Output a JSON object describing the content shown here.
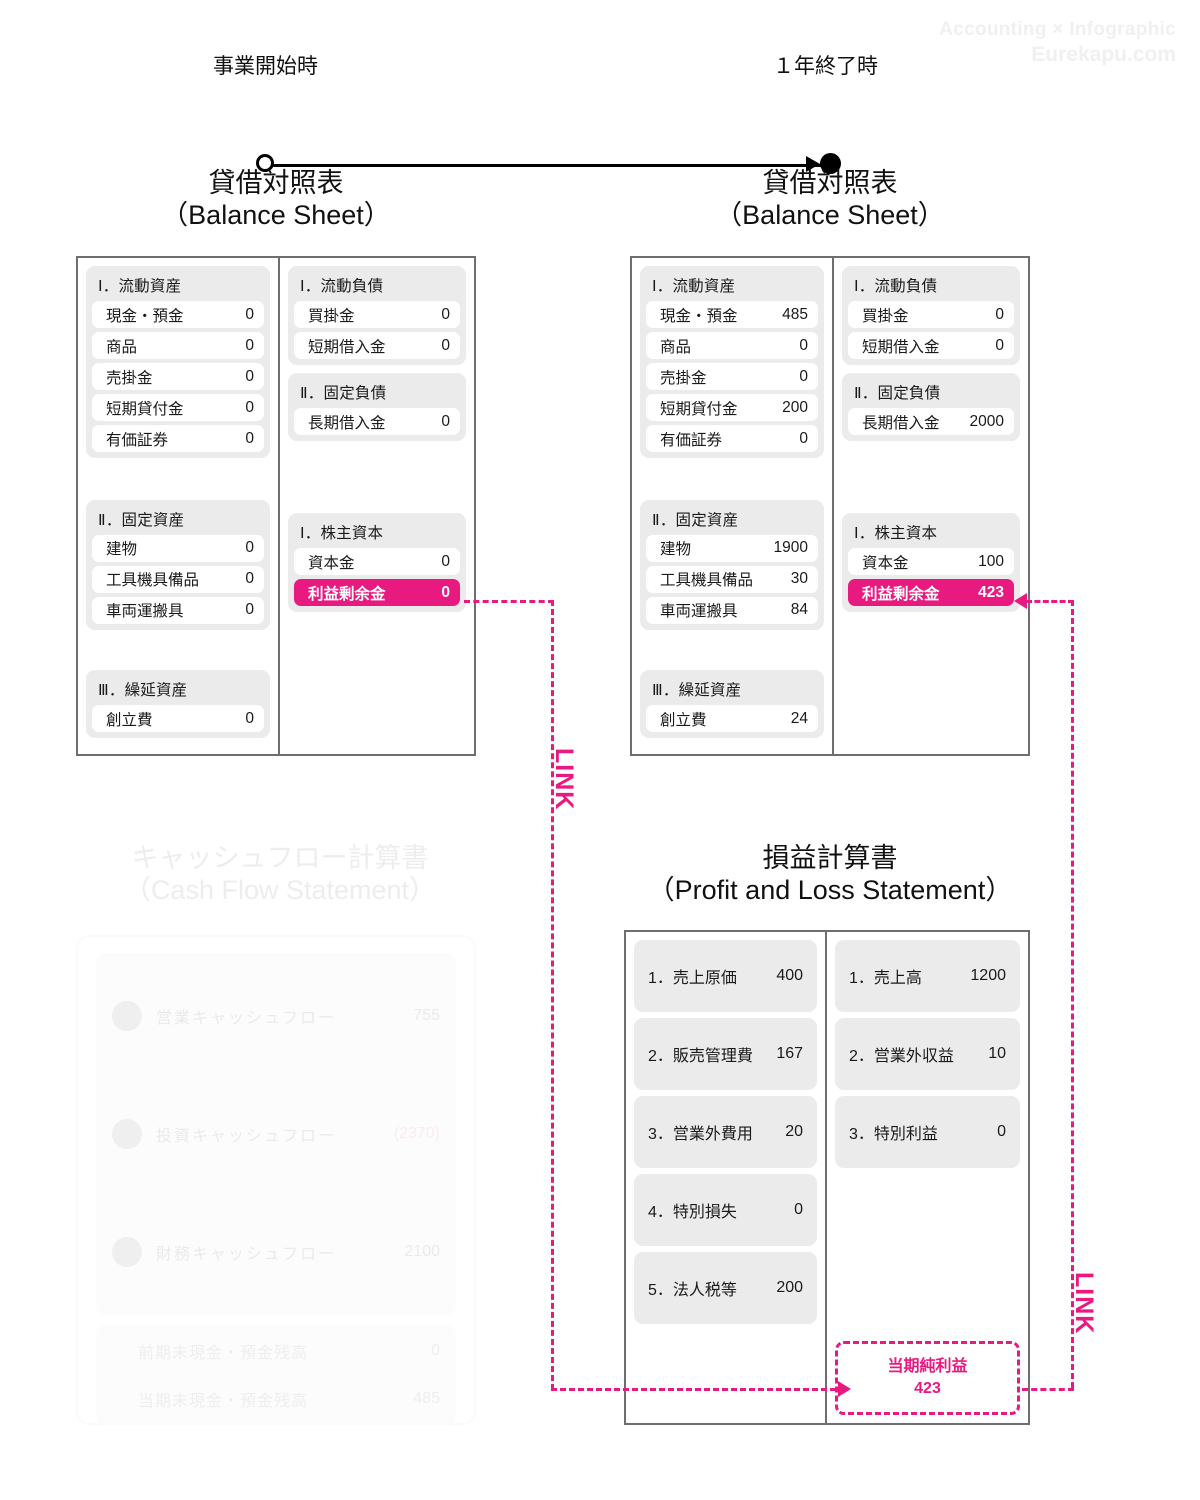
{
  "watermark": {
    "line1": "Accounting × Infographic",
    "line2": "Eurekapu.com"
  },
  "timeline": {
    "start_label": "事業開始時",
    "end_label": "１年終了時"
  },
  "colors": {
    "accent_pink": "#e8197f",
    "group_bg": "#ebebeb",
    "border_gray": "#6e6e6e"
  },
  "balance_sheet_start": {
    "title_jp": "貸借対照表",
    "title_en": "（Balance Sheet）",
    "assets": [
      {
        "header": "Ⅰ．流動資産",
        "rows": [
          {
            "name": "現金・預金",
            "value": "0"
          },
          {
            "name": "商品",
            "value": "0"
          },
          {
            "name": "売掛金",
            "value": "0"
          },
          {
            "name": "短期貸付金",
            "value": "0"
          },
          {
            "name": "有価証券",
            "value": "0"
          }
        ]
      },
      {
        "header": "Ⅱ．固定資産",
        "rows": [
          {
            "name": "建物",
            "value": "0"
          },
          {
            "name": "工具機具備品",
            "value": "0"
          },
          {
            "name": "車両運搬具",
            "value": "0"
          }
        ]
      },
      {
        "header": "Ⅲ．繰延資産",
        "rows": [
          {
            "name": "創立費",
            "value": "0"
          }
        ]
      }
    ],
    "liabilities": [
      {
        "header": "Ⅰ．流動負債",
        "rows": [
          {
            "name": "買掛金",
            "value": "0"
          },
          {
            "name": "短期借入金",
            "value": "0"
          }
        ]
      },
      {
        "header": "Ⅱ．固定負債",
        "rows": [
          {
            "name": "長期借入金",
            "value": "0"
          }
        ]
      }
    ],
    "equity": {
      "header": "Ⅰ．株主資本",
      "rows": [
        {
          "name": "資本金",
          "value": "0",
          "highlight": false
        },
        {
          "name": "利益剰余金",
          "value": "0",
          "highlight": true
        }
      ]
    }
  },
  "balance_sheet_end": {
    "title_jp": "貸借対照表",
    "title_en": "（Balance Sheet）",
    "assets": [
      {
        "header": "Ⅰ．流動資産",
        "rows": [
          {
            "name": "現金・預金",
            "value": "485"
          },
          {
            "name": "商品",
            "value": "0"
          },
          {
            "name": "売掛金",
            "value": "0"
          },
          {
            "name": "短期貸付金",
            "value": "200"
          },
          {
            "name": "有価証券",
            "value": "0"
          }
        ]
      },
      {
        "header": "Ⅱ．固定資産",
        "rows": [
          {
            "name": "建物",
            "value": "1900"
          },
          {
            "name": "工具機具備品",
            "value": "30"
          },
          {
            "name": "車両運搬具",
            "value": "84"
          }
        ]
      },
      {
        "header": "Ⅲ．繰延資産",
        "rows": [
          {
            "name": "創立費",
            "value": "24"
          }
        ]
      }
    ],
    "liabilities": [
      {
        "header": "Ⅰ．流動負債",
        "rows": [
          {
            "name": "買掛金",
            "value": "0"
          },
          {
            "name": "短期借入金",
            "value": "0"
          }
        ]
      },
      {
        "header": "Ⅱ．固定負債",
        "rows": [
          {
            "name": "長期借入金",
            "value": "2000"
          }
        ]
      }
    ],
    "equity": {
      "header": "Ⅰ．株主資本",
      "rows": [
        {
          "name": "資本金",
          "value": "100",
          "highlight": false
        },
        {
          "name": "利益剰余金",
          "value": "423",
          "highlight": true
        }
      ]
    }
  },
  "profit_loss": {
    "title_jp": "損益計算書",
    "title_en": "（Profit and Loss Statement）",
    "expenses": [
      {
        "name": "1．売上原価",
        "value": "400"
      },
      {
        "name": "2．販売管理費",
        "value": "167"
      },
      {
        "name": "3．営業外費用",
        "value": "20"
      },
      {
        "name": "4．特別損失",
        "value": "0"
      },
      {
        "name": "5．法人税等",
        "value": "200"
      }
    ],
    "revenues": [
      {
        "name": "1．売上高",
        "value": "1200"
      },
      {
        "name": "2．営業外収益",
        "value": "10"
      },
      {
        "name": "3．特別利益",
        "value": "0"
      }
    ],
    "net_income": {
      "label": "当期純利益",
      "value": "423"
    }
  },
  "cash_flow": {
    "title_jp": "キャッシュフロー計算書",
    "title_en": "（Cash Flow Statement）",
    "rows": [
      {
        "name": "営業キャッシュフロー",
        "value": "755",
        "negative": false
      },
      {
        "name": "投資キャッシュフロー",
        "value": "(2370)",
        "negative": true
      },
      {
        "name": "財務キャッシュフロー",
        "value": "2100",
        "negative": false
      }
    ],
    "footer_rows": [
      {
        "name": "前期末現金・預金残高",
        "value": "0"
      },
      {
        "name": "当期末現金・預金残高",
        "value": "485"
      }
    ]
  },
  "links": {
    "left_label": "LINK",
    "right_label": "LINK"
  }
}
